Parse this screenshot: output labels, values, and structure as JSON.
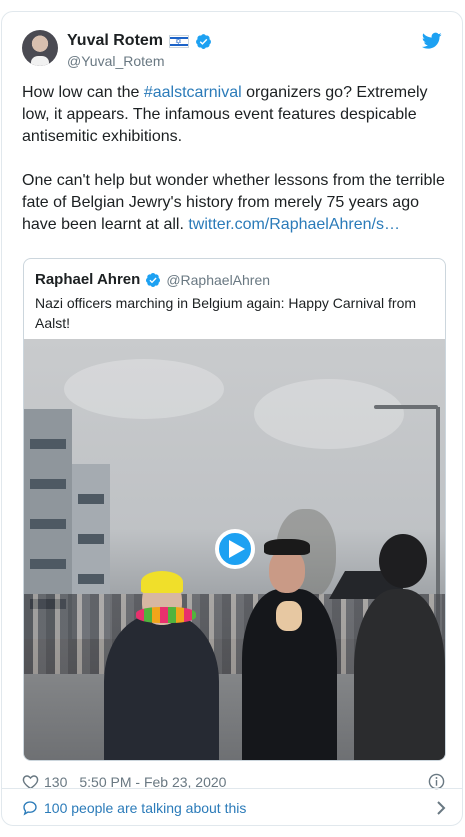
{
  "author": {
    "name": "Yuval Rotem",
    "handle": "@Yuval_Rotem"
  },
  "tweet": {
    "text_before": "How low can the ",
    "hashtag": "#aalstcarnival",
    "text_after": " organizers go? Extremely low, it appears. The infamous event features despicable antisemitic exhibitions.\n\nOne can't help but wonder whether lessons from the terrible fate of Belgian Jewry's history from merely 75 years ago have been learnt at all. ",
    "link": "twitter.com/RaphaelAhren/s…"
  },
  "quoted_tweet": {
    "name": "Raphael Ahren",
    "handle": "@RaphaelAhren",
    "text": "Nazi officers marching in Belgium again: Happy Carnival from Aalst!"
  },
  "footer": {
    "likes": "130",
    "timestamp": "5:50 PM - Feb 23, 2020"
  },
  "conversation": {
    "label": "100 people are talking about this"
  },
  "icons": {
    "brand": "twitter-bird-icon",
    "verified": "verified-badge-icon",
    "like": "heart-icon",
    "info": "info-icon",
    "conversation": "speech-bubble-icon",
    "more": "chevron-right-icon",
    "video": "play-icon"
  },
  "colors": {
    "twitter_blue": "#1da1f2",
    "link": "#2b7bb9",
    "text": "#1c2022",
    "secondary_text": "#697882",
    "border": "#e1e8ed"
  }
}
